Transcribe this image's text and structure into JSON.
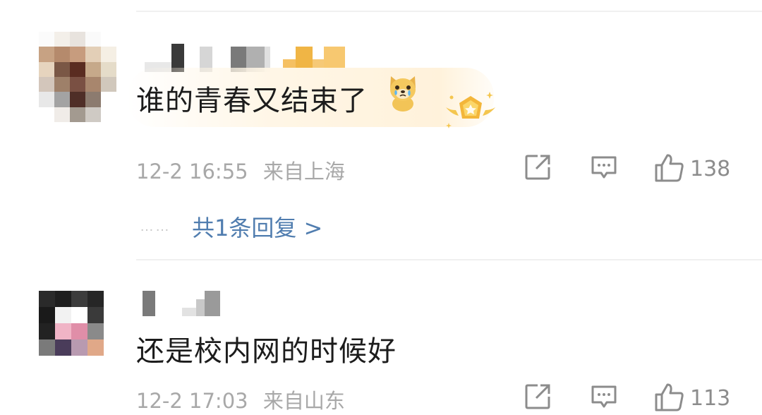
{
  "comments": [
    {
      "text": "谁的青春又结束了",
      "emoji": "crying-doge-emoji",
      "badge": "gold-star-badge",
      "time": "12-2 16:55",
      "location": "来自上海",
      "likes": "138",
      "replies_label": "共1条回复 >",
      "replies_dots": "……"
    },
    {
      "text": "还是校内网的时候好",
      "time": "12-2 17:03",
      "location": "来自山东",
      "likes": "113"
    }
  ],
  "icons": {
    "share": "share-icon",
    "comment": "comment-icon",
    "like": "thumbs-up-icon"
  },
  "colors": {
    "text": "#1c1c1c",
    "meta": "#a8a8a8",
    "link": "#507daf",
    "icon": "#8c8c8c",
    "highlight": "#fff2db"
  }
}
